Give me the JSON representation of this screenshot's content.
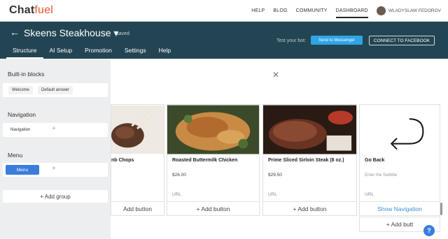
{
  "app": {
    "logo_a": "Chat",
    "logo_b": "fuel"
  },
  "topnav": {
    "help": "HELP",
    "blog": "BLOG",
    "community": "COMMUNITY",
    "dashboard": "DASHBOARD",
    "user": "WLADYSLAW FEDOROV"
  },
  "header": {
    "back_icon": "←",
    "bot_name": "Skeens Steakhouse ▾",
    "saved": "Saved",
    "test_label": "Test your bot:",
    "send_messenger": "Send to Messenger",
    "connect_fb": "CONNECT TO FACEBOOK"
  },
  "tabs": [
    {
      "label": "Structure"
    },
    {
      "label": "AI Setup"
    },
    {
      "label": "Promotion"
    },
    {
      "label": "Settings"
    },
    {
      "label": "Help"
    }
  ],
  "sidebar": {
    "builtin_title": "Built-in blocks",
    "builtin": [
      {
        "label": "Welcome"
      },
      {
        "label": "Default answer"
      }
    ],
    "nav_title": "Navigation",
    "nav": [
      {
        "label": "Navigation"
      }
    ],
    "menu_title": "Menu",
    "menu": [
      {
        "label": "Menu"
      }
    ],
    "plus": "+",
    "add_group": "+ Add group"
  },
  "modal": {
    "close_icon": "✕"
  },
  "gallery": [
    {
      "title": "nb Chops",
      "price": "",
      "url": "",
      "button": "Add button",
      "image": "lamb-chops-photo"
    },
    {
      "title": "Roasted Buttermilk Chicken",
      "price": "$26.00",
      "url": "URL",
      "button": "+ Add button",
      "image": "chicken-photo"
    },
    {
      "title": "Prime Sliced Sirloin Steak (8 oz.)",
      "price": "$29.50",
      "url": "URL",
      "button": "+ Add button",
      "image": "steak-photo"
    },
    {
      "title": "Go Back",
      "subtitle": "Enter the Subtitle",
      "url": "URL",
      "button": "Show Navigation",
      "image": "return-arrow-icon"
    }
  ],
  "extra_button": "+ Add butt",
  "help_icon": "?"
}
